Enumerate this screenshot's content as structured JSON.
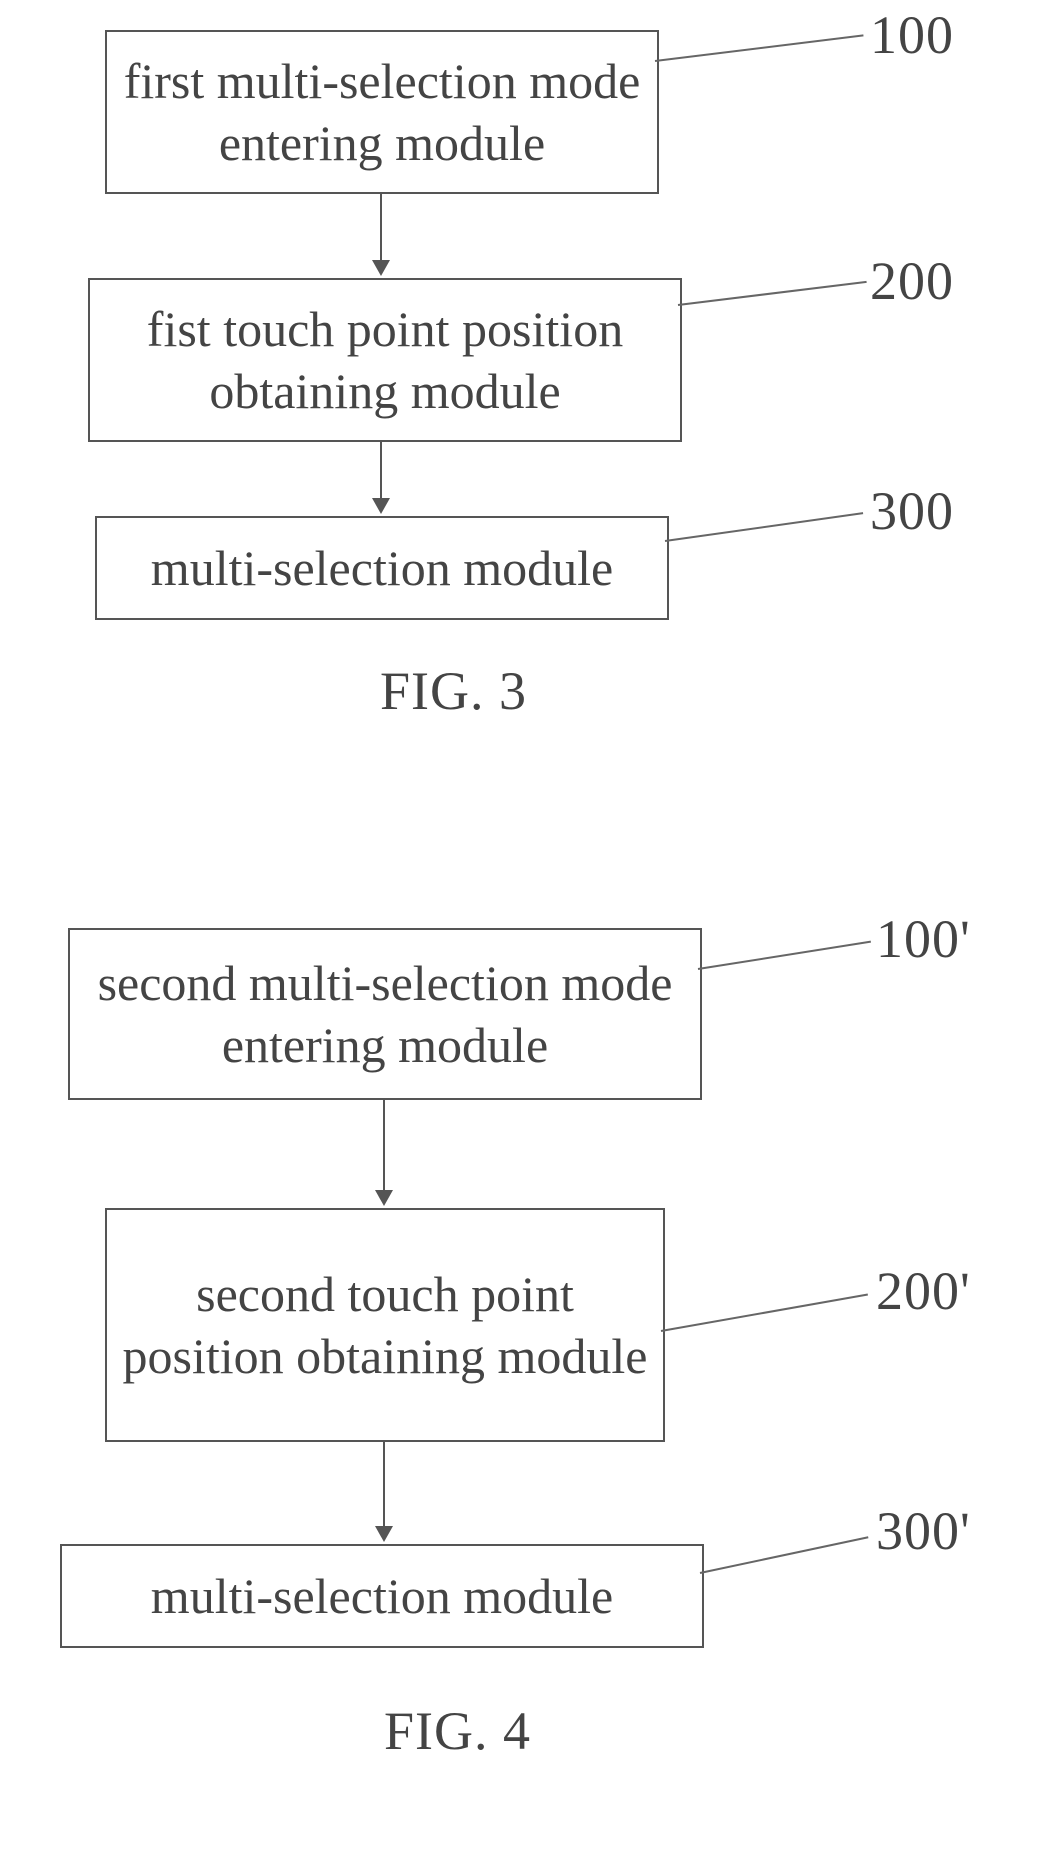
{
  "fig3": {
    "caption": "FIG. 3",
    "boxes": {
      "b100": {
        "text": "first multi-selection mode entering module",
        "ref": "100"
      },
      "b200": {
        "text": "fist touch point position obtaining module",
        "ref": "200"
      },
      "b300": {
        "text": "multi-selection module",
        "ref": "300"
      }
    }
  },
  "fig4": {
    "caption": "FIG. 4",
    "boxes": {
      "b100p": {
        "text": "second multi-selection mode entering module",
        "ref": "100'"
      },
      "b200p": {
        "text": "second  touch point position obtaining module",
        "ref": "200'"
      },
      "b300p": {
        "text": "multi-selection module",
        "ref": "300'"
      }
    }
  }
}
